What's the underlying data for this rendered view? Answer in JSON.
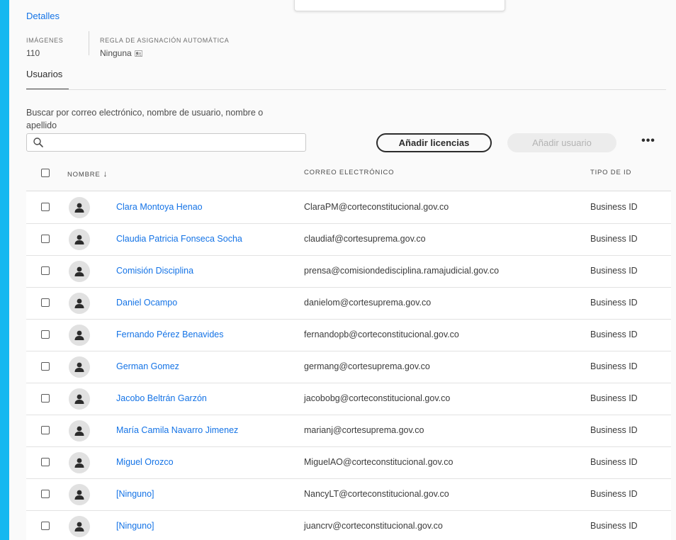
{
  "details": {
    "title": "Detalles",
    "images_label": "IMÁGENES",
    "images_value": "110",
    "rule_label": "REGLA DE ASIGNACIÓN AUTOMÁTICA",
    "rule_value": "Ninguna",
    "rule_icon": "edit-icon"
  },
  "tabs": [
    {
      "label": "Usuarios",
      "active": true
    }
  ],
  "search": {
    "label": "Buscar por correo electrónico, nombre de usuario, nombre o apellido",
    "value": "",
    "placeholder": ""
  },
  "actions": {
    "add_licenses": "Añadir licencias",
    "add_user": "Añadir usuario",
    "more": "•••"
  },
  "table": {
    "headers": {
      "name": "NOMBRE",
      "email": "CORREO ELECTRÓNICO",
      "id_type": "TIPO DE ID"
    },
    "sort": {
      "column": "name",
      "direction": "descending"
    },
    "rows": [
      {
        "name": "Clara Montoya Henao",
        "email": "ClaraPM@corteconstitucional.gov.co",
        "id_type": "Business ID"
      },
      {
        "name": "Claudia Patricia Fonseca Socha",
        "email": "claudiaf@cortesuprema.gov.co",
        "id_type": "Business ID"
      },
      {
        "name": "Comisión Disciplina",
        "email": "prensa@comisiondedisciplina.ramajudicial.gov.co",
        "id_type": "Business ID"
      },
      {
        "name": "Daniel Ocampo",
        "email": "danielom@cortesuprema.gov.co",
        "id_type": "Business ID"
      },
      {
        "name": "Fernando Pérez Benavides",
        "email": "fernandopb@corteconstitucional.gov.co",
        "id_type": "Business ID"
      },
      {
        "name": "German Gomez",
        "email": "germang@cortesuprema.gov.co",
        "id_type": "Business ID"
      },
      {
        "name": "Jacobo Beltrán Garzón",
        "email": "jacobobg@corteconstitucional.gov.co",
        "id_type": "Business ID"
      },
      {
        "name": "María Camila Navarro Jimenez",
        "email": "marianj@cortesuprema.gov.co",
        "id_type": "Business ID"
      },
      {
        "name": "Miguel Orozco",
        "email": "MiguelAO@corteconstitucional.gov.co",
        "id_type": "Business ID"
      },
      {
        "name": "[Ninguno]",
        "email": "NancyLT@corteconstitucional.gov.co",
        "id_type": "Business ID"
      },
      {
        "name": "[Ninguno]",
        "email": "juancrv@corteconstitucional.gov.co",
        "id_type": "Business ID"
      }
    ]
  },
  "colors": {
    "frame": "#15b8f0",
    "link": "#1473e6",
    "background": "#fafafa"
  }
}
